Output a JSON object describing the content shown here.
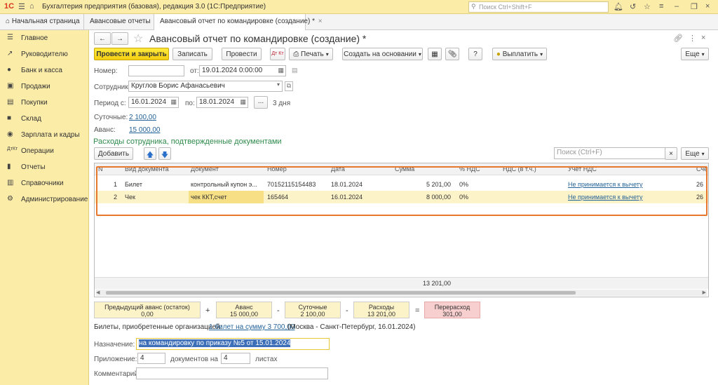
{
  "app": {
    "logo": "1С",
    "title": "Бухгалтерия предприятия (базовая), редакция 3.0  (1С:Предприятие)",
    "search_placeholder": "Поиск Ctrl+Shift+F"
  },
  "tabs": {
    "home": "Начальная страница",
    "t1": "Авансовые отчеты",
    "t2": "Авансовый отчет по командировке (создание) *"
  },
  "sidebar": {
    "main": "Главное",
    "manager": "Руководителю",
    "bank": "Банк и касса",
    "sales": "Продажи",
    "purchases": "Покупки",
    "warehouse": "Склад",
    "salary": "Зарплата и кадры",
    "operations": "Операции",
    "reports": "Отчеты",
    "directories": "Справочники",
    "admin": "Администрирование"
  },
  "doc": {
    "title": "Авансовый отчет по командировке (создание) *",
    "post_close": "Провести и закрыть",
    "save": "Записать",
    "post": "Провести",
    "dtkt": "Дт Кт",
    "print": "Печать",
    "create_based": "Создать на основании",
    "pay": "Выплатить",
    "help": "?",
    "more": "Еще",
    "number_label": "Номер:",
    "number_value": "",
    "date_label": "от:",
    "date_value": "19.01.2024  0:00:00",
    "employee_label": "Сотрудник:",
    "employee_value": "Круглов Борис Афанасьевич",
    "period_label": "Период с:",
    "period_from": "16.01.2024",
    "period_to_label": "по:",
    "period_to": "18.01.2024",
    "period_days": "3 дня",
    "dots": "...",
    "daily_label": "Суточные:",
    "daily_value": "2 100,00",
    "advance_label": "Аванс:",
    "advance_value": "15 000,00"
  },
  "expenses": {
    "section_title": "Расходы сотрудника, подтвержденные документами",
    "add": "Добавить",
    "search_placeholder": "Поиск (Ctrl+F)",
    "more": "Еще",
    "columns": {
      "n": "N",
      "doc_type": "Вид документа",
      "doc": "Документ",
      "number": "Номер",
      "date": "Дата",
      "sum": "Сумма",
      "vat_pct": "% НДС",
      "vat": "НДС (в т.ч.)",
      "vat_acc": "Учет НДС",
      "acc": "Сче"
    },
    "rows": [
      {
        "n": "1",
        "doc_type": "Билет",
        "doc": "контрольный купон э...",
        "number": "70152115154483",
        "date": "18.01.2024",
        "sum": "5 201,00",
        "vat_pct": "0%",
        "vat": "",
        "vat_acc": "Не принимается к вычету",
        "acc": "26"
      },
      {
        "n": "2",
        "doc_type": "Чек",
        "doc": "чек ККТ,счет",
        "number": "165464",
        "date": "16.01.2024",
        "sum": "8 000,00",
        "vat_pct": "0%",
        "vat": "",
        "vat_acc": "Не принимается к вычету",
        "acc": "26"
      }
    ],
    "total": "13 201,00"
  },
  "summary": {
    "prev_label": "Предыдущий аванс (остаток)",
    "prev_value": "0,00",
    "plus": "+",
    "advance_label": "Аванс",
    "advance_value": "15 000,00",
    "minus1": "-",
    "daily_label": "Суточные",
    "daily_value": "2 100,00",
    "minus2": "-",
    "exp_label": "Расходы",
    "exp_value": "13 201,00",
    "eq": "=",
    "over_label": "Перерасход",
    "over_value": "301,00"
  },
  "tickets": {
    "label": "Билеты, приобретенные организацией:",
    "link": "1 билет на сумму 3 700,00",
    "note": "(Москва - Санкт-Петербург, 16.01.2024)"
  },
  "purpose": {
    "label": "Назначение:",
    "value": "на командировку по приказу №5 от 15.01.2024"
  },
  "attachment": {
    "label": "Приложение:",
    "docs": "4",
    "docs_label": "документов на",
    "sheets": "4",
    "sheets_label": "листах"
  },
  "comment": {
    "label": "Комментарий:",
    "value": ""
  }
}
